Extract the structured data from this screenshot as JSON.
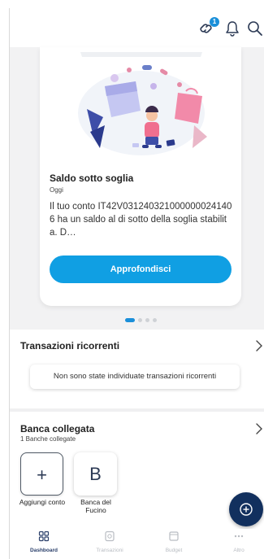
{
  "header": {
    "link_badge": "1"
  },
  "card": {
    "title": "Saldo sotto soglia",
    "date": "Oggi",
    "body": "Il tuo conto IT42V0312403210000000241406 ha un saldo al di sotto della soglia stabilita. D…",
    "cta_label": "Approfondisci"
  },
  "carousel": {
    "page_count": 4,
    "active_index": 0
  },
  "recurring": {
    "title": "Transazioni ricorrenti",
    "empty_message": "Non sono state individuate transazioni ricorrenti"
  },
  "banks": {
    "title": "Banca collegata",
    "subtitle": "1 Banche collegate",
    "add_glyph": "+",
    "add_label": "Aggiungi conto",
    "items": [
      {
        "initial": "B",
        "label": "Banca del Fucino"
      }
    ]
  },
  "nav": {
    "items": [
      {
        "label": "Dashboard",
        "icon": "dashboard-icon",
        "active": true
      },
      {
        "label": "Transazioni",
        "icon": "transactions-icon",
        "active": false
      },
      {
        "label": "Budget",
        "icon": "budget-icon",
        "active": false
      },
      {
        "label": "Altro",
        "icon": "more-icon",
        "active": false
      }
    ]
  },
  "colors": {
    "primary": "#109fe3",
    "navy": "#12305e",
    "badge": "#1a8fd9"
  }
}
